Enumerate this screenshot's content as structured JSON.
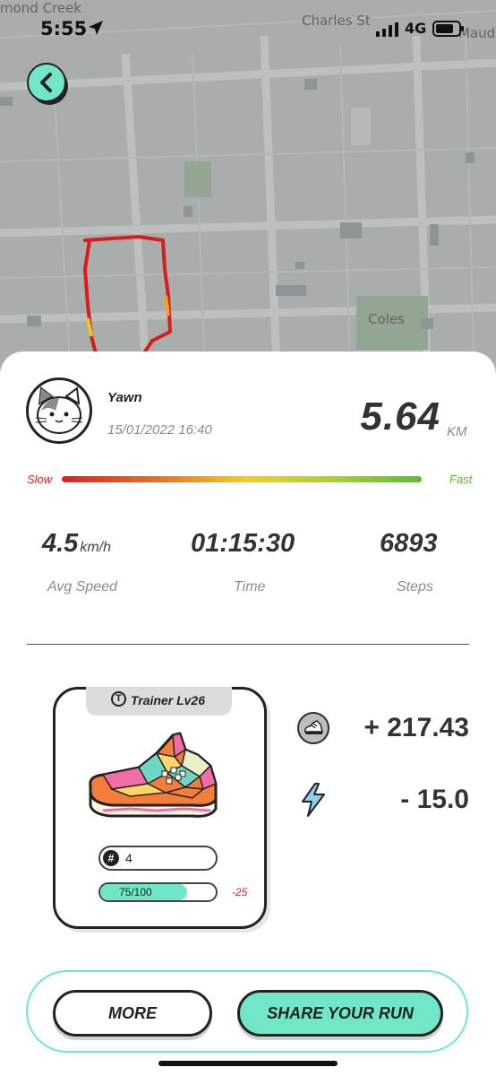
{
  "status_bar": {
    "time": "5:55",
    "network": "4G"
  },
  "map": {
    "labels": [
      "mond Creek",
      "Charles St",
      "Maud",
      "Coles"
    ]
  },
  "run": {
    "username": "Yawn",
    "datetime": "15/01/2022 16:40",
    "distance": "5.64",
    "distance_unit": "KM",
    "pace_scale": {
      "slow": "Slow",
      "fast": "Fast"
    },
    "stats": [
      {
        "value": "4.5",
        "unit": "km/h",
        "label": "Avg Speed"
      },
      {
        "value": "01:15:30",
        "label": "Time"
      },
      {
        "value": "6893",
        "label": "Steps"
      }
    ]
  },
  "sneaker": {
    "badge": "T",
    "title": "Trainer Lv26",
    "mint_symbol": "#",
    "mint_value": "4",
    "durability_text": "75/100",
    "durability_fraction": 0.75,
    "durability_change": "-25"
  },
  "rewards": [
    {
      "icon": "gst-token-icon",
      "value": "+ 217.43"
    },
    {
      "icon": "energy-bolt-icon",
      "value": "- 15.0"
    }
  ],
  "actions": {
    "more": "MORE",
    "share": "SHARE YOUR RUN"
  },
  "colors": {
    "accent": "#72e6c8",
    "slow": "#e0231d",
    "fast": "#5cbb2c",
    "route": "#d81b1b"
  }
}
